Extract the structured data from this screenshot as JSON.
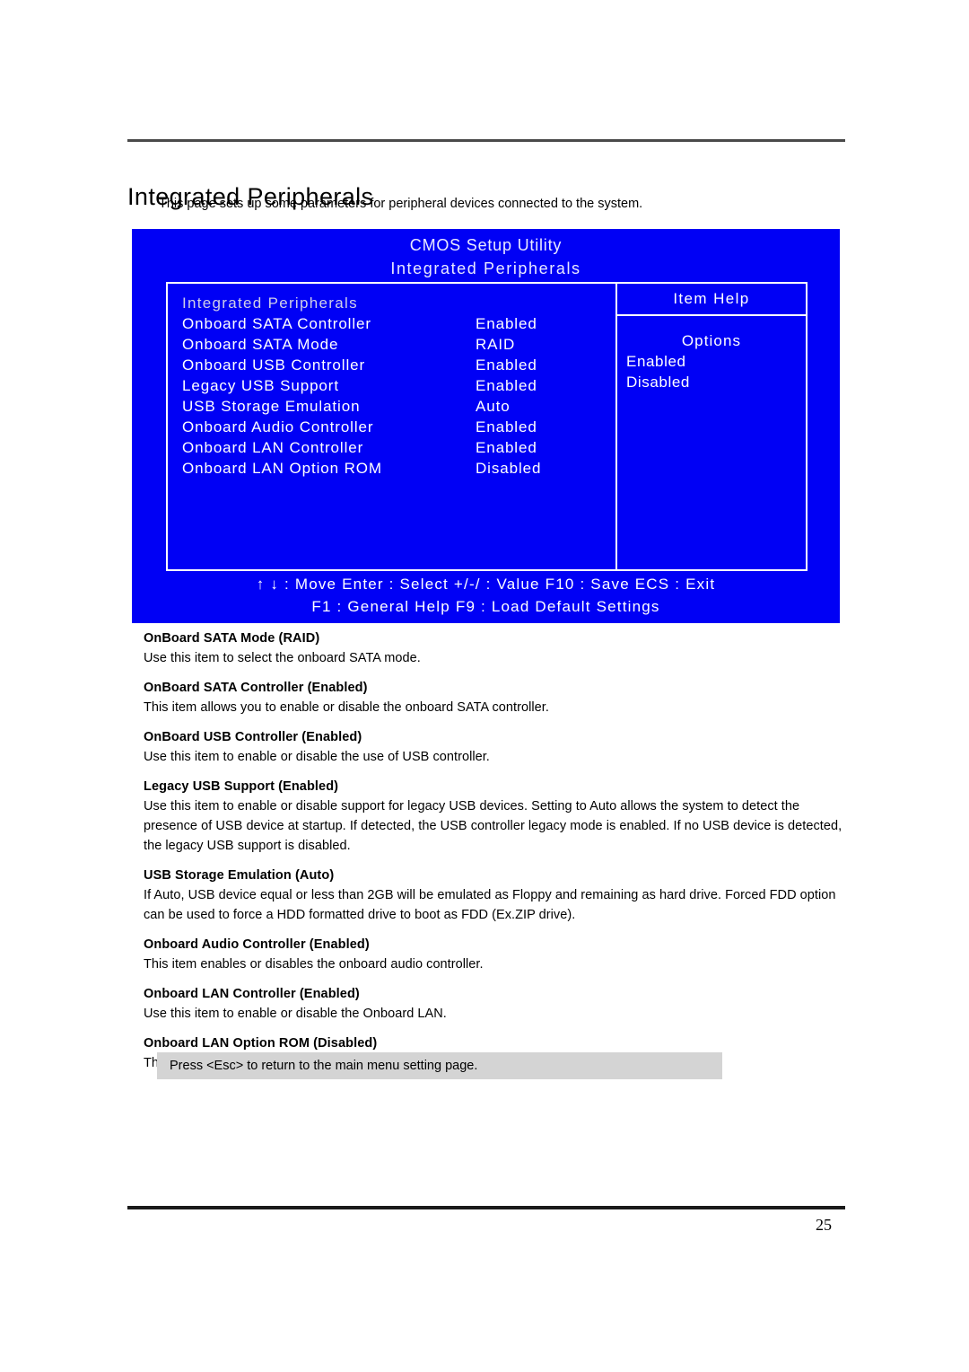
{
  "page": {
    "title": "Integrated Peripherals",
    "subtitle": "This page sets up some parameters for peripheral devices connected to the system.",
    "number": "25"
  },
  "bios": {
    "header_line1": "CMOS Setup Utility",
    "header_line2": "Integrated Peripherals",
    "group_label": "Integrated Peripherals",
    "rows": [
      {
        "label": "Onboard SATA Controller",
        "value": "Enabled"
      },
      {
        "label": "Onboard SATA Mode",
        "value": "RAID"
      },
      {
        "label": "Onboard USB Controller",
        "value": "Enabled"
      },
      {
        "label": "Legacy USB Support",
        "value": "Enabled"
      },
      {
        "label": "USB Storage Emulation",
        "value": "Auto"
      },
      {
        "label": "Onboard Audio Controller",
        "value": "Enabled"
      },
      {
        "label": "Onboard LAN Controller",
        "value": "Enabled"
      },
      {
        "label": "Onboard LAN Option ROM",
        "value": "Disabled"
      }
    ],
    "help": {
      "title": "Item Help",
      "options_title": "Options",
      "options": [
        "Enabled",
        "Disabled"
      ]
    },
    "footer_line1": "↑ ↓ : Move   Enter : Select   +/-/ : Value   F10 : Save ECS : Exit",
    "footer_line2": "F1 : General Help     F9 : Load Default Settings",
    "colors": {
      "screen_blue": "#0000F5",
      "text_white": "#FFFFFF",
      "group_text": "#CFCFE8"
    }
  },
  "descriptions": [
    {
      "heading": "OnBoard SATA Mode (RAID)",
      "body": "Use this item to select the onboard SATA mode."
    },
    {
      "heading": "OnBoard SATA Controller (Enabled)",
      "body": "This item allows you to enable or disable the onboard SATA controller."
    },
    {
      "heading": "OnBoard USB Controller (Enabled)",
      "body": "Use this item to enable or disable the use of USB controller."
    },
    {
      "heading": "Legacy USB Support (Enabled)",
      "body": "Use this item to enable or disable support for legacy USB devices. Setting to Auto allows the system to detect the presence of USB device at startup. If detected, the USB controller legacy mode is enabled. If no USB device is detected, the legacy USB support is disabled."
    },
    {
      "heading": "USB Storage Emulation (Auto)",
      "body": "If Auto, USB device equal or less than 2GB will be emulated as Floppy and remaining as hard drive. Forced FDD option can be used to force a HDD formatted drive to boot as FDD (Ex.ZIP drive)."
    },
    {
      "heading": "Onboard Audio Controller (Enabled)",
      "body": "This item enables or disables the onboard audio controller."
    },
    {
      "heading": "Onboard LAN Controller (Enabled)",
      "body": "Use this item to enable or disable the Onboard LAN."
    },
    {
      "heading": "Onboard LAN Option ROM (Disabled)",
      "body": "This item enables or disables the onboard LAN option ROM function."
    }
  ],
  "note": "Press <Esc> to return to the main menu setting page."
}
